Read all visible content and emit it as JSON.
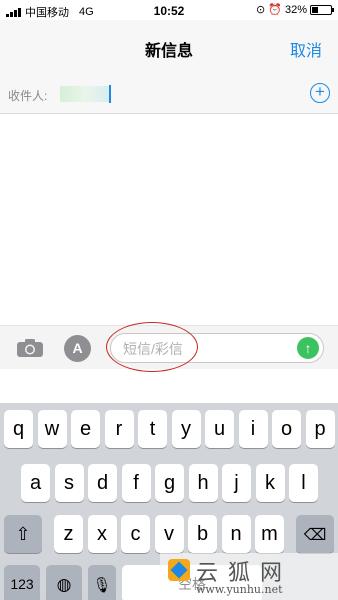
{
  "status_bar": {
    "carrier": "中国移动",
    "network": "4G",
    "time": "10:52",
    "battery": "32%",
    "battery_level": 0.32
  },
  "nav": {
    "title": "新信息",
    "cancel": "取消"
  },
  "recipient": {
    "label": "收件人:"
  },
  "compose": {
    "placeholder": "短信/彩信"
  },
  "keyboard": {
    "row1": [
      "q",
      "w",
      "e",
      "r",
      "t",
      "y",
      "u",
      "i",
      "o",
      "p"
    ],
    "row2": [
      "a",
      "s",
      "d",
      "f",
      "g",
      "h",
      "j",
      "k",
      "l"
    ],
    "row3": [
      "z",
      "x",
      "c",
      "v",
      "b",
      "n",
      "m"
    ],
    "numbers": "123",
    "space": "空格"
  },
  "watermark": {
    "title": "云狐网",
    "url": "www.yunhu.net"
  },
  "colors": {
    "accent": "#1e88e5",
    "send": "#3cc35f",
    "annotation": "#c62828"
  }
}
